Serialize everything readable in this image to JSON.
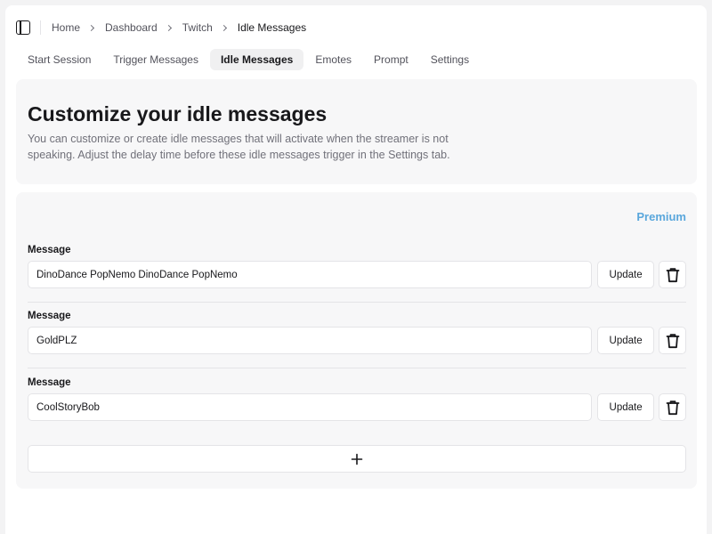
{
  "breadcrumb": {
    "items": [
      "Home",
      "Dashboard",
      "Twitch"
    ],
    "current": "Idle Messages"
  },
  "tabs": [
    {
      "label": "Start Session",
      "active": false
    },
    {
      "label": "Trigger Messages",
      "active": false
    },
    {
      "label": "Idle Messages",
      "active": true
    },
    {
      "label": "Emotes",
      "active": false
    },
    {
      "label": "Prompt",
      "active": false
    },
    {
      "label": "Settings",
      "active": false
    }
  ],
  "intro": {
    "title": "Customize your idle messages",
    "description": "You can customize or create idle messages that will activate when the streamer is not speaking. Adjust the delay time before these idle messages trigger in the Settings tab."
  },
  "messages_section": {
    "premium_label": "Premium",
    "field_label": "Message",
    "update_label": "Update",
    "items": [
      {
        "value": "DinoDance PopNemo DinoDance PopNemo"
      },
      {
        "value": "GoldPLZ"
      },
      {
        "value": "CoolStoryBob"
      }
    ]
  },
  "icons": {
    "sidebar_toggle": "sidebar-toggle-icon",
    "chevron": "chevron-right-icon",
    "delete": "trash-icon",
    "add": "plus-icon"
  },
  "colors": {
    "premium": "#5aa7dc",
    "card_background": "#f7f7f8",
    "active_tab_background": "#f0f0f1"
  }
}
